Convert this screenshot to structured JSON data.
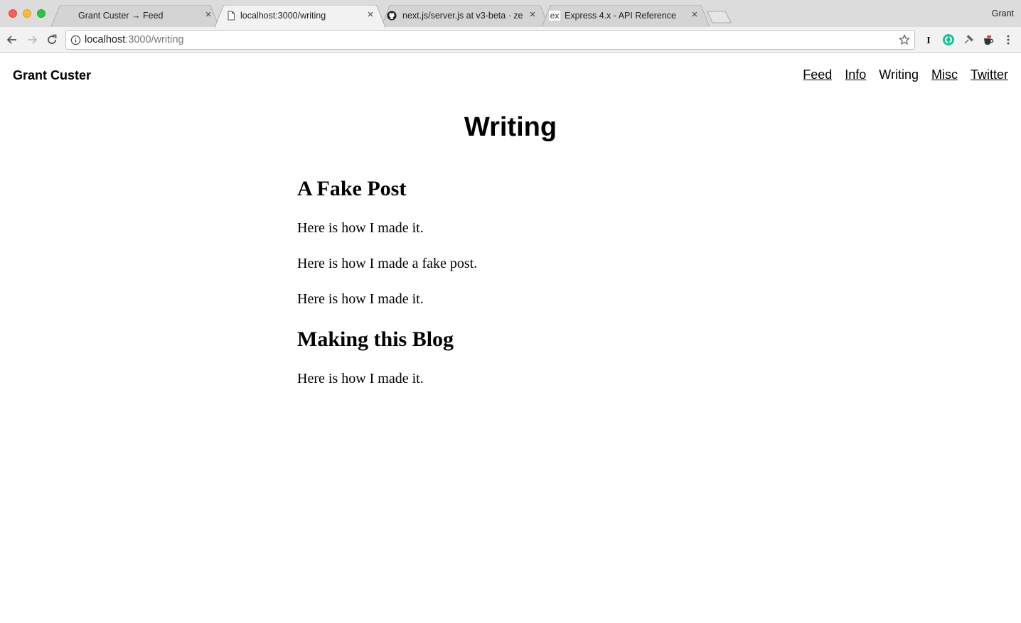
{
  "browser": {
    "tabs": [
      {
        "title": "Grant Custer → Feed",
        "favicon": "none",
        "active": false
      },
      {
        "title": "localhost:3000/writing",
        "favicon": "document-icon",
        "active": true
      },
      {
        "title": "next.js/server.js at v3-beta · ze",
        "favicon": "github-icon",
        "active": false
      },
      {
        "title": "Express 4.x - API Reference",
        "favicon": "express-ex-icon",
        "favicon_text": "ex",
        "active": false
      }
    ],
    "profile_name": "Grant",
    "address": {
      "host": "localhost",
      "path": ":3000/writing"
    },
    "extension_icons": [
      "instapaper-i-icon",
      "grammarly-icon",
      "pin-icon",
      "coffee-icon",
      "menu-dots-icon"
    ]
  },
  "site": {
    "title": "Grant Custer",
    "nav": [
      {
        "label": "Feed",
        "current": false
      },
      {
        "label": "Info",
        "current": false
      },
      {
        "label": "Writing",
        "current": true
      },
      {
        "label": "Misc",
        "current": false
      },
      {
        "label": "Twitter",
        "current": false
      }
    ]
  },
  "page": {
    "heading": "Writing",
    "posts": [
      {
        "title": "A Fake Post",
        "paragraphs": [
          "Here is how I made it.",
          "Here is how I made a fake post.",
          "Here is how I made it."
        ]
      },
      {
        "title": "Making this Blog",
        "paragraphs": [
          "Here is how I made it."
        ]
      }
    ]
  }
}
